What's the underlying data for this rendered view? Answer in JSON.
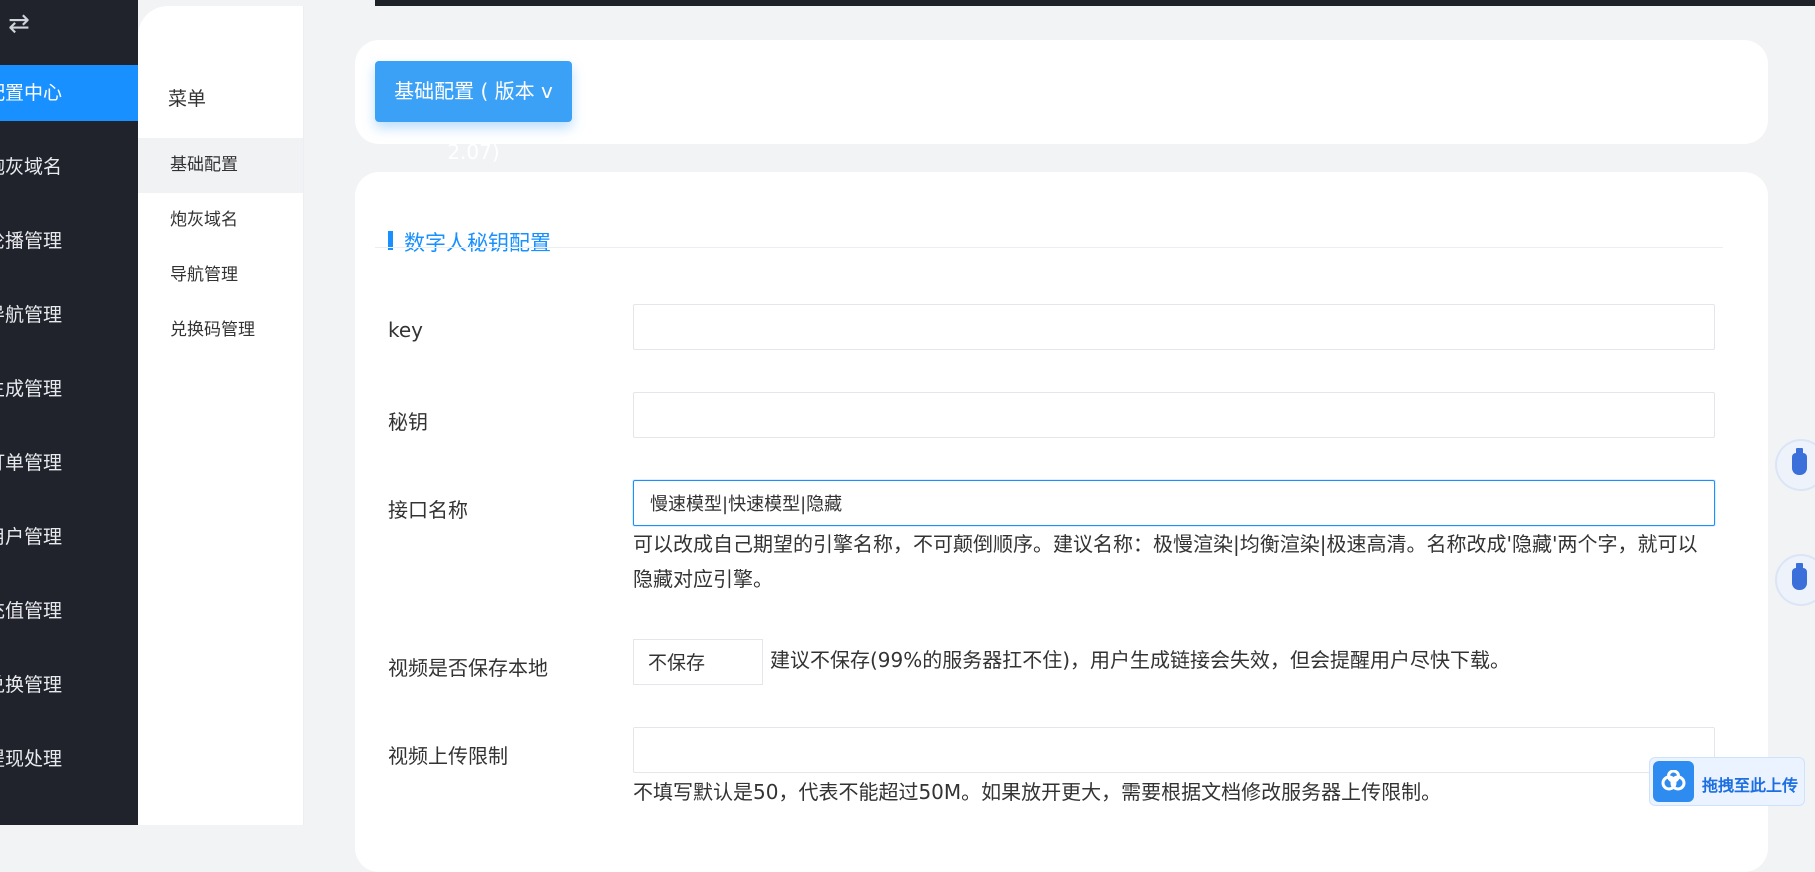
{
  "sidebar": {
    "toggle_icon": "swap-icon",
    "items": [
      {
        "label": "配置中心",
        "active": true
      },
      {
        "label": "炮灰域名"
      },
      {
        "label": "轮播管理"
      },
      {
        "label": "导航管理"
      },
      {
        "label": "生成管理"
      },
      {
        "label": "订单管理"
      },
      {
        "label": "用户管理"
      },
      {
        "label": "充值管理"
      },
      {
        "label": "兑换管理"
      },
      {
        "label": "提现处理"
      }
    ]
  },
  "submenu": {
    "title": "菜单",
    "items": [
      {
        "label": "基础配置",
        "active": true
      },
      {
        "label": "炮灰域名"
      },
      {
        "label": "导航管理"
      },
      {
        "label": "兑换码管理"
      }
    ]
  },
  "header": {
    "version_button": "基础配置 ( 版本 v 2.07)"
  },
  "form": {
    "section_title": "数字人秘钥配置",
    "key": {
      "label": "key",
      "value": ""
    },
    "secret": {
      "label": "秘钥",
      "value": ""
    },
    "api_name": {
      "label": "接口名称",
      "value": "慢速模型|快速模型|隐藏",
      "hint": "可以改成自己期望的引擎名称，不可颠倒顺序。建议名称：极慢渲染|均衡渲染|极速高清。名称改成'隐藏'两个字，就可以隐藏对应引擎。"
    },
    "save_local": {
      "label": "视频是否保存本地",
      "selected": "不保存",
      "hint": "建议不保存(99%的服务器扛不住)，用户生成链接会失效，但会提醒用户尽快下载。"
    },
    "upload_limit": {
      "label": "视频上传限制",
      "value": "",
      "hint": "不填写默认是50，代表不能超过50M。如果放开更大，需要根据文档修改服务器上传限制。"
    }
  },
  "widgets": {
    "upload_text": "拖拽至此上传",
    "accent": "#1890ff"
  }
}
